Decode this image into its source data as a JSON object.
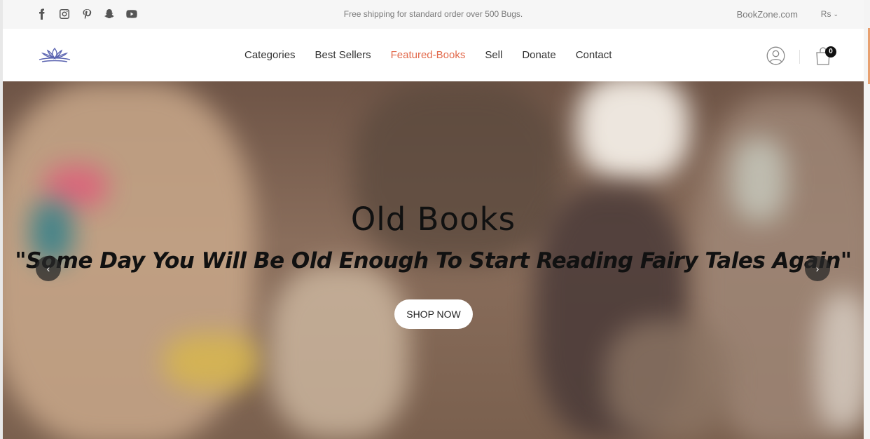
{
  "topbar": {
    "social": [
      {
        "icon": "facebook-icon"
      },
      {
        "icon": "instagram-icon"
      },
      {
        "icon": "pinterest-icon"
      },
      {
        "icon": "snapchat-icon"
      },
      {
        "icon": "youtube-icon"
      }
    ],
    "shipping_text": "Free shipping for standard order over 500 Bugs.",
    "site_link": "BookZone.com",
    "currency": "Rs"
  },
  "header": {
    "logo_icon": "lotus-logo-icon",
    "nav": [
      {
        "label": "Categories",
        "active": false
      },
      {
        "label": "Best Sellers",
        "active": false
      },
      {
        "label": "Featured-Books",
        "active": true
      },
      {
        "label": "Sell",
        "active": false
      },
      {
        "label": "Donate",
        "active": false
      },
      {
        "label": "Contact",
        "active": false
      }
    ],
    "cart_count": "0",
    "accent_color": "#e2694b"
  },
  "hero": {
    "title": "Old Books",
    "quote": "\"Some Day You Will Be Old Enough To Start Reading Fairy Tales Again\"",
    "cta": "SHOP NOW",
    "prev_icon": "chevron-left-icon",
    "next_icon": "chevron-right-icon"
  }
}
